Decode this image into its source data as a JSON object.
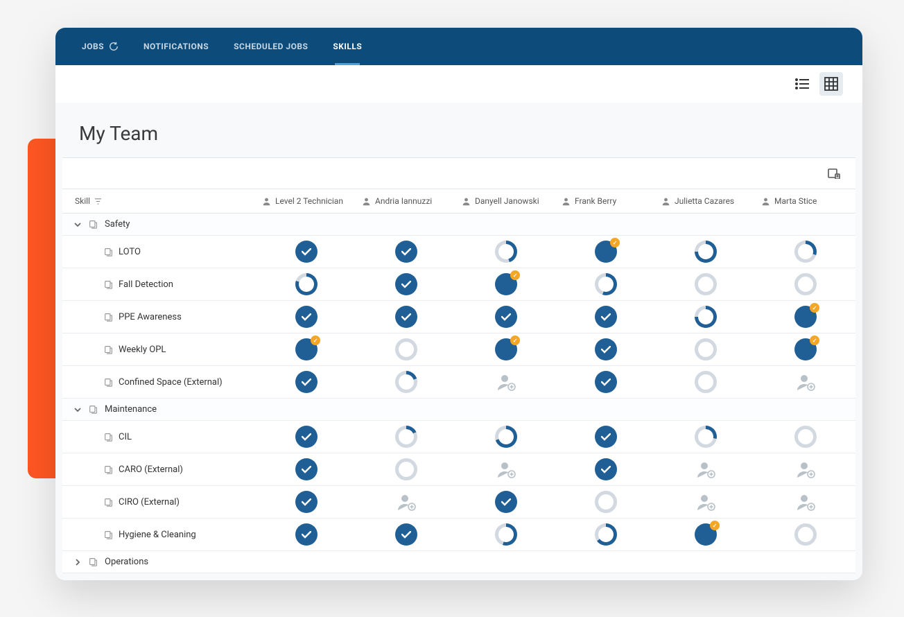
{
  "nav": {
    "items": [
      {
        "label": "JOBS",
        "has_refresh": true
      },
      {
        "label": "NOTIFICATIONS"
      },
      {
        "label": "SCHEDULED JOBS"
      },
      {
        "label": "SKILLS",
        "active": true
      }
    ]
  },
  "view_toggles": {
    "list": false,
    "grid": true
  },
  "page_title": "My Team",
  "columns": {
    "skill_header": "Skill",
    "people": [
      "Level 2 Technician",
      "Andria Iannuzzi",
      "Danyell Janowski",
      "Frank Berry",
      "Julietta Cazares",
      "Marta Stice"
    ]
  },
  "status_legend": {
    "check": "complete (checkmark)",
    "pieNN": "partial progress NN%",
    "empty": "not started",
    "add": "not assigned"
  },
  "groups": [
    {
      "name": "Safety",
      "expanded": true,
      "skills": [
        {
          "name": "LOTO",
          "statuses": [
            {
              "type": "check"
            },
            {
              "type": "check"
            },
            {
              "type": "pie",
              "pct": 45
            },
            {
              "type": "pie",
              "pct": 95,
              "badge": true
            },
            {
              "type": "pie",
              "pct": 75
            },
            {
              "type": "pie",
              "pct": 30
            }
          ]
        },
        {
          "name": "Fall Detection",
          "statuses": [
            {
              "type": "pie",
              "pct": 80
            },
            {
              "type": "check"
            },
            {
              "type": "pie",
              "pct": 95,
              "badge": true
            },
            {
              "type": "pie",
              "pct": 55
            },
            {
              "type": "empty"
            },
            {
              "type": "empty"
            }
          ]
        },
        {
          "name": "PPE Awareness",
          "statuses": [
            {
              "type": "check"
            },
            {
              "type": "check"
            },
            {
              "type": "check"
            },
            {
              "type": "check"
            },
            {
              "type": "pie",
              "pct": 75
            },
            {
              "type": "pie",
              "pct": 95,
              "badge": true
            }
          ]
        },
        {
          "name": "Weekly OPL",
          "statuses": [
            {
              "type": "pie",
              "pct": 100,
              "badge": true
            },
            {
              "type": "empty"
            },
            {
              "type": "pie",
              "pct": 95,
              "badge": true
            },
            {
              "type": "check"
            },
            {
              "type": "empty"
            },
            {
              "type": "pie",
              "pct": 100,
              "badge": true
            }
          ]
        },
        {
          "name": "Confined Space (External)",
          "statuses": [
            {
              "type": "check"
            },
            {
              "type": "pie",
              "pct": 20
            },
            {
              "type": "add"
            },
            {
              "type": "check"
            },
            {
              "type": "empty"
            },
            {
              "type": "add"
            }
          ]
        }
      ]
    },
    {
      "name": "Maintenance",
      "expanded": true,
      "skills": [
        {
          "name": "CIL",
          "statuses": [
            {
              "type": "check"
            },
            {
              "type": "pie",
              "pct": 18
            },
            {
              "type": "pie",
              "pct": 70
            },
            {
              "type": "check"
            },
            {
              "type": "pie",
              "pct": 28
            },
            {
              "type": "empty"
            }
          ]
        },
        {
          "name": "CARO (External)",
          "statuses": [
            {
              "type": "check"
            },
            {
              "type": "empty"
            },
            {
              "type": "add"
            },
            {
              "type": "check"
            },
            {
              "type": "add"
            },
            {
              "type": "add"
            }
          ]
        },
        {
          "name": "CIRO (External)",
          "statuses": [
            {
              "type": "check"
            },
            {
              "type": "add"
            },
            {
              "type": "check"
            },
            {
              "type": "empty"
            },
            {
              "type": "add"
            },
            {
              "type": "add"
            }
          ]
        },
        {
          "name": "Hygiene & Cleaning",
          "statuses": [
            {
              "type": "check"
            },
            {
              "type": "check"
            },
            {
              "type": "pie",
              "pct": 55
            },
            {
              "type": "pie",
              "pct": 65
            },
            {
              "type": "pie",
              "pct": 95,
              "badge": true
            },
            {
              "type": "empty"
            }
          ]
        }
      ]
    },
    {
      "name": "Operations",
      "expanded": false,
      "skills": []
    }
  ],
  "colors": {
    "brand_blue": "#1f5f95",
    "nav_bg": "#0d4c7a",
    "accent_orange": "#ff5722",
    "badge": "#f5a623",
    "ring_empty": "#d2d9e0"
  }
}
